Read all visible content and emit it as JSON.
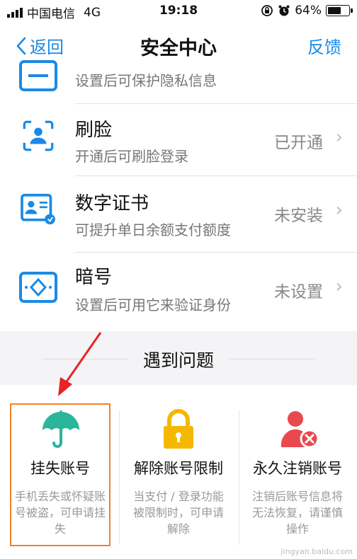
{
  "status_bar": {
    "carrier": "中国电信",
    "network": "4G",
    "time": "19:18",
    "battery": "64%",
    "battery_level": 0.64
  },
  "nav": {
    "back_label": "返回",
    "title": "安全中心",
    "feedback_label": "反馈"
  },
  "security_items": [
    {
      "name": "",
      "desc": "设置后可保护隐私信息",
      "status": ""
    },
    {
      "name": "刷脸",
      "desc": "开通后可刷脸登录",
      "status": "已开通"
    },
    {
      "name": "数字证书",
      "desc": "可提升单日余额支付额度",
      "status": "未安装"
    },
    {
      "name": "暗号",
      "desc": "设置后可用它来验证身份",
      "status": "未设置"
    }
  ],
  "problems": {
    "title": "遇到问题",
    "cards": [
      {
        "title": "挂失账号",
        "desc": "手机丢失或怀疑账号被盗，可申请挂失"
      },
      {
        "title": "解除账号限制",
        "desc": "当支付 / 登录功能被限制时，可申请解除"
      },
      {
        "title": "永久注销账号",
        "desc": "注销后账号信息将无法恢复，请谨慎操作"
      }
    ]
  },
  "colors": {
    "accent": "#1a8ae6",
    "highlight": "#f0832a",
    "umbrella": "#2bb59a",
    "lock": "#f5b800",
    "user_delete": "#e8494e"
  },
  "watermark": "jingyan.baidu.com"
}
